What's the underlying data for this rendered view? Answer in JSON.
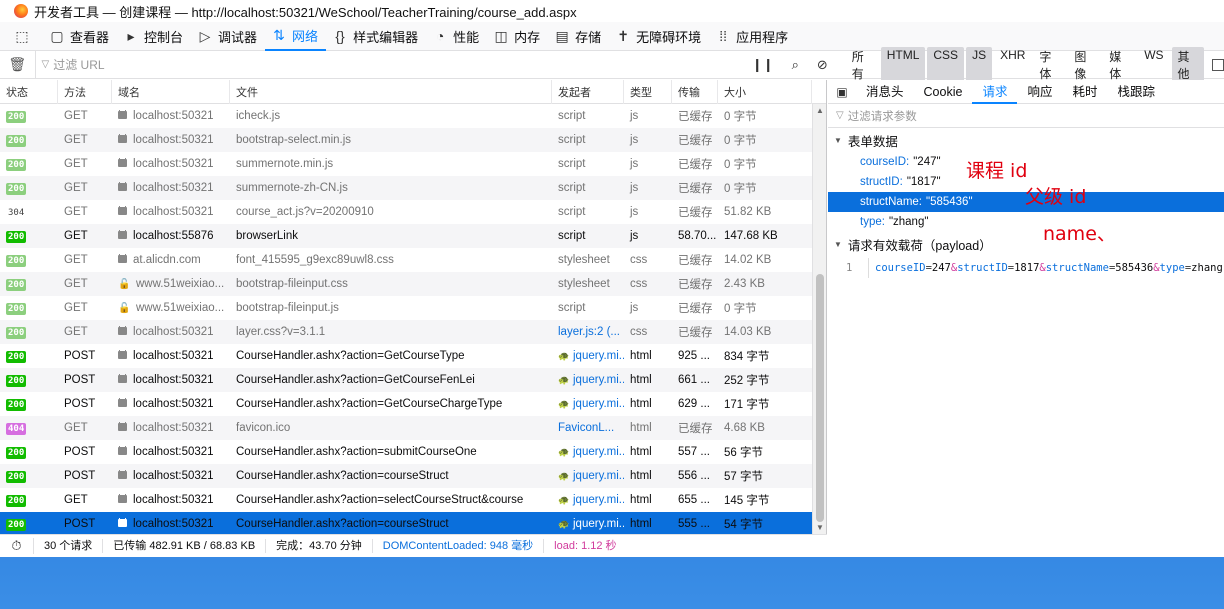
{
  "window": {
    "title": "开发者工具 — 创建课程 — http://localhost:50321/WeSchool/TeacherTraining/course_add.aspx"
  },
  "toolbar": {
    "items": [
      {
        "label": "",
        "icon": "inspector-pick-icon"
      },
      {
        "label": "查看器",
        "icon": "inspector-icon"
      },
      {
        "label": "控制台",
        "icon": "console-icon"
      },
      {
        "label": "调试器",
        "icon": "debugger-icon"
      },
      {
        "label": "网络",
        "icon": "network-icon",
        "active": true
      },
      {
        "label": "样式编辑器",
        "icon": "style-editor-icon"
      },
      {
        "label": "性能",
        "icon": "performance-icon"
      },
      {
        "label": "内存",
        "icon": "memory-icon"
      },
      {
        "label": "存储",
        "icon": "storage-icon"
      },
      {
        "label": "无障碍环境",
        "icon": "accessibility-icon"
      },
      {
        "label": "应用程序",
        "icon": "application-icon"
      }
    ]
  },
  "filterbar": {
    "placeholder": "过滤 URL",
    "types": [
      {
        "label": "所有",
        "on": false
      },
      {
        "label": "HTML",
        "on": true
      },
      {
        "label": "CSS",
        "on": true
      },
      {
        "label": "JS",
        "on": true
      },
      {
        "label": "XHR",
        "on": false
      },
      {
        "label": "字体",
        "on": false
      },
      {
        "label": "图像",
        "on": false
      },
      {
        "label": "媒体",
        "on": false
      },
      {
        "label": "WS",
        "on": false
      },
      {
        "label": "其他",
        "on": true
      }
    ]
  },
  "columns": [
    "状态",
    "方法",
    "域名",
    "文件",
    "发起者",
    "类型",
    "传输",
    "大小"
  ],
  "requests": [
    {
      "status": "200",
      "kind": "cached",
      "method": "GET",
      "domain": "localhost:50321",
      "lock": "secure",
      "file": "icheck.js",
      "initiator": "script",
      "init_link": false,
      "type": "js",
      "transfer": "已缓存",
      "size": "0 字节"
    },
    {
      "status": "200",
      "kind": "cached",
      "method": "GET",
      "domain": "localhost:50321",
      "lock": "secure",
      "file": "bootstrap-select.min.js",
      "initiator": "script",
      "init_link": false,
      "type": "js",
      "transfer": "已缓存",
      "size": "0 字节"
    },
    {
      "status": "200",
      "kind": "cached",
      "method": "GET",
      "domain": "localhost:50321",
      "lock": "secure",
      "file": "summernote.min.js",
      "initiator": "script",
      "init_link": false,
      "type": "js",
      "transfer": "已缓存",
      "size": "0 字节"
    },
    {
      "status": "200",
      "kind": "cached",
      "method": "GET",
      "domain": "localhost:50321",
      "lock": "secure",
      "file": "summernote-zh-CN.js",
      "initiator": "script",
      "init_link": false,
      "type": "js",
      "transfer": "已缓存",
      "size": "0 字节"
    },
    {
      "status": "304",
      "kind": "plain",
      "method": "GET",
      "domain": "localhost:50321",
      "lock": "secure",
      "file": "course_act.js?v=20200910",
      "initiator": "script",
      "init_link": false,
      "type": "js",
      "transfer": "已缓存",
      "size": "51.82 KB"
    },
    {
      "status": "200",
      "kind": "ok",
      "method": "GET",
      "domain": "localhost:55876",
      "lock": "secure",
      "file": "browserLink",
      "initiator": "script",
      "init_link": false,
      "type": "js",
      "transfer": "58.70...",
      "size": "147.68 KB",
      "live": true
    },
    {
      "status": "200",
      "kind": "cached",
      "method": "GET",
      "domain": "at.alicdn.com",
      "lock": "secure",
      "file": "font_415595_g9exc89uwl8.css",
      "initiator": "stylesheet",
      "init_link": false,
      "type": "css",
      "transfer": "已缓存",
      "size": "14.02 KB"
    },
    {
      "status": "200",
      "kind": "cached",
      "method": "GET",
      "domain": "www.51weixiao...",
      "lock": "broken",
      "file": "bootstrap-fileinput.css",
      "initiator": "stylesheet",
      "init_link": false,
      "type": "css",
      "transfer": "已缓存",
      "size": "2.43 KB"
    },
    {
      "status": "200",
      "kind": "cached",
      "method": "GET",
      "domain": "www.51weixiao...",
      "lock": "broken",
      "file": "bootstrap-fileinput.js",
      "initiator": "script",
      "init_link": false,
      "type": "js",
      "transfer": "已缓存",
      "size": "0 字节"
    },
    {
      "status": "200",
      "kind": "cached",
      "method": "GET",
      "domain": "localhost:50321",
      "lock": "secure",
      "file": "layer.css?v=3.1.1",
      "initiator": "layer.js:2 (...",
      "init_link": true,
      "type": "css",
      "transfer": "已缓存",
      "size": "14.03 KB"
    },
    {
      "status": "200",
      "kind": "ok",
      "method": "POST",
      "domain": "localhost:50321",
      "lock": "secure",
      "file": "CourseHandler.ashx?action=GetCourseType",
      "initiator": "jquery.mi...",
      "init_link": true,
      "turtle": true,
      "type": "html",
      "transfer": "925 ...",
      "size": "834 字节",
      "live": true
    },
    {
      "status": "200",
      "kind": "ok",
      "method": "POST",
      "domain": "localhost:50321",
      "lock": "secure",
      "file": "CourseHandler.ashx?action=GetCourseFenLei",
      "initiator": "jquery.mi...",
      "init_link": true,
      "turtle": true,
      "type": "html",
      "transfer": "661 ...",
      "size": "252 字节",
      "live": true
    },
    {
      "status": "200",
      "kind": "ok",
      "method": "POST",
      "domain": "localhost:50321",
      "lock": "secure",
      "file": "CourseHandler.ashx?action=GetCourseChargeType",
      "initiator": "jquery.mi...",
      "init_link": true,
      "turtle": true,
      "type": "html",
      "transfer": "629 ...",
      "size": "171 字节",
      "live": true
    },
    {
      "status": "404",
      "kind": "err",
      "method": "GET",
      "domain": "localhost:50321",
      "lock": "secure",
      "file": "favicon.ico",
      "initiator": "FaviconL...",
      "init_link": true,
      "type": "html",
      "transfer": "已缓存",
      "size": "4.68 KB"
    },
    {
      "status": "200",
      "kind": "ok",
      "method": "POST",
      "domain": "localhost:50321",
      "lock": "secure",
      "file": "CourseHandler.ashx?action=submitCourseOne",
      "initiator": "jquery.mi...",
      "init_link": true,
      "turtle": true,
      "type": "html",
      "transfer": "557 ...",
      "size": "56 字节",
      "live": true
    },
    {
      "status": "200",
      "kind": "ok",
      "method": "POST",
      "domain": "localhost:50321",
      "lock": "secure",
      "file": "CourseHandler.ashx?action=courseStruct",
      "initiator": "jquery.mi...",
      "init_link": true,
      "turtle": true,
      "type": "html",
      "transfer": "556 ...",
      "size": "57 字节",
      "live": true
    },
    {
      "status": "200",
      "kind": "ok",
      "method": "GET",
      "domain": "localhost:50321",
      "lock": "secure",
      "file": "CourseHandler.ashx?action=selectCourseStruct&course",
      "initiator": "jquery.mi...",
      "init_link": true,
      "turtle": true,
      "type": "html",
      "transfer": "655 ...",
      "size": "145 字节",
      "live": true
    },
    {
      "status": "200",
      "kind": "ok",
      "method": "POST",
      "domain": "localhost:50321",
      "lock": "secure",
      "file": "CourseHandler.ashx?action=courseStruct",
      "initiator": "jquery.mi...",
      "init_link": true,
      "turtle": true,
      "type": "html",
      "transfer": "555 ...",
      "size": "54 字节",
      "live": true,
      "selected": true
    }
  ],
  "statusbar": {
    "count": "30 个请求",
    "transferred": "已传输 482.91 KB / 68.83 KB",
    "finish": "完成：43.70 分钟",
    "dom": "DOMContentLoaded: 948 毫秒",
    "load": "load: 1.12 秒"
  },
  "details": {
    "tabs": [
      "消息头",
      "Cookie",
      "请求",
      "响应",
      "耗时",
      "栈跟踪"
    ],
    "active_tab": "请求",
    "filter_placeholder": "过滤请求参数",
    "form_section": "表单数据",
    "form": [
      {
        "key": "courseID:",
        "value": "\"247\""
      },
      {
        "key": "structID:",
        "value": "\"1817\""
      },
      {
        "key": "structName:",
        "value": "\"585436\"",
        "selected": true
      },
      {
        "key": "type:",
        "value": "\"zhang\""
      }
    ],
    "payload_section": "请求有效载荷（payload）",
    "payload_line_no": "1",
    "payload": [
      {
        "k": "courseID",
        "v": "247"
      },
      {
        "k": "structID",
        "v": "1817"
      },
      {
        "k": "structName",
        "v": "585436"
      },
      {
        "k": "type",
        "v": "zhang"
      }
    ]
  },
  "annotations": [
    {
      "text": "课程 id"
    },
    {
      "text": "父级 id"
    },
    {
      "text": "name、"
    }
  ],
  "colors": {
    "accent": "#0a84ff",
    "selected_row": "#0a6fdc",
    "status_ok": "#12bc00",
    "annotation": "#e0000f"
  }
}
